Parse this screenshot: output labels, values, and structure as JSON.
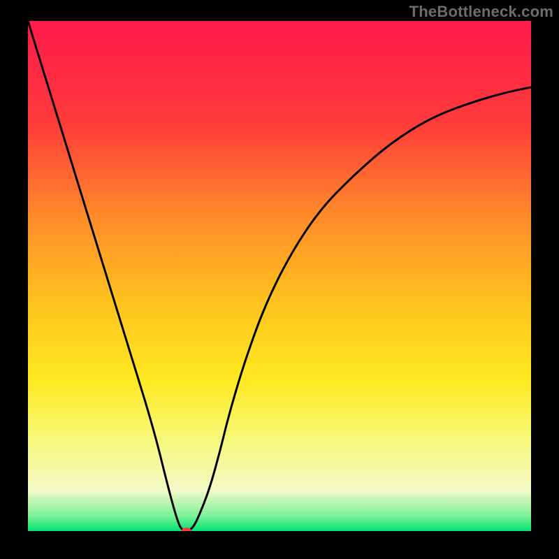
{
  "attribution": "TheBottleneck.com",
  "chart_data": {
    "type": "line",
    "title": "",
    "xlabel": "",
    "ylabel": "",
    "xlim": [
      0,
      100
    ],
    "ylim": [
      0,
      100
    ],
    "grid": false,
    "legend": false,
    "background_gradient_stops": [
      {
        "offset": 0,
        "color": "#ff1a4b"
      },
      {
        "offset": 20,
        "color": "#ff3b3b"
      },
      {
        "offset": 38,
        "color": "#ff8a2a"
      },
      {
        "offset": 55,
        "color": "#ffc21f"
      },
      {
        "offset": 70,
        "color": "#ffe81f"
      },
      {
        "offset": 82,
        "color": "#f7f97a"
      },
      {
        "offset": 92,
        "color": "#f3f9c8"
      },
      {
        "offset": 97,
        "color": "#7cf29a"
      },
      {
        "offset": 100,
        "color": "#00e472"
      }
    ],
    "series": [
      {
        "name": "bottleneck-curve",
        "x": [
          0,
          5,
          10,
          15,
          20,
          25,
          28,
          30,
          31,
          32,
          33,
          34,
          36,
          38,
          40,
          43,
          47,
          52,
          58,
          65,
          72,
          80,
          88,
          95,
          100
        ],
        "y": [
          100,
          84,
          68,
          52,
          36,
          20,
          8,
          1,
          0,
          0,
          1,
          3,
          8,
          15,
          23,
          33,
          44,
          54,
          63,
          70,
          76,
          81,
          84,
          86,
          87
        ]
      }
    ],
    "marker": {
      "name": "optimal-point",
      "x": 31.5,
      "y": 0,
      "color": "#ff3b3b",
      "rx": 7,
      "ry": 5
    }
  }
}
